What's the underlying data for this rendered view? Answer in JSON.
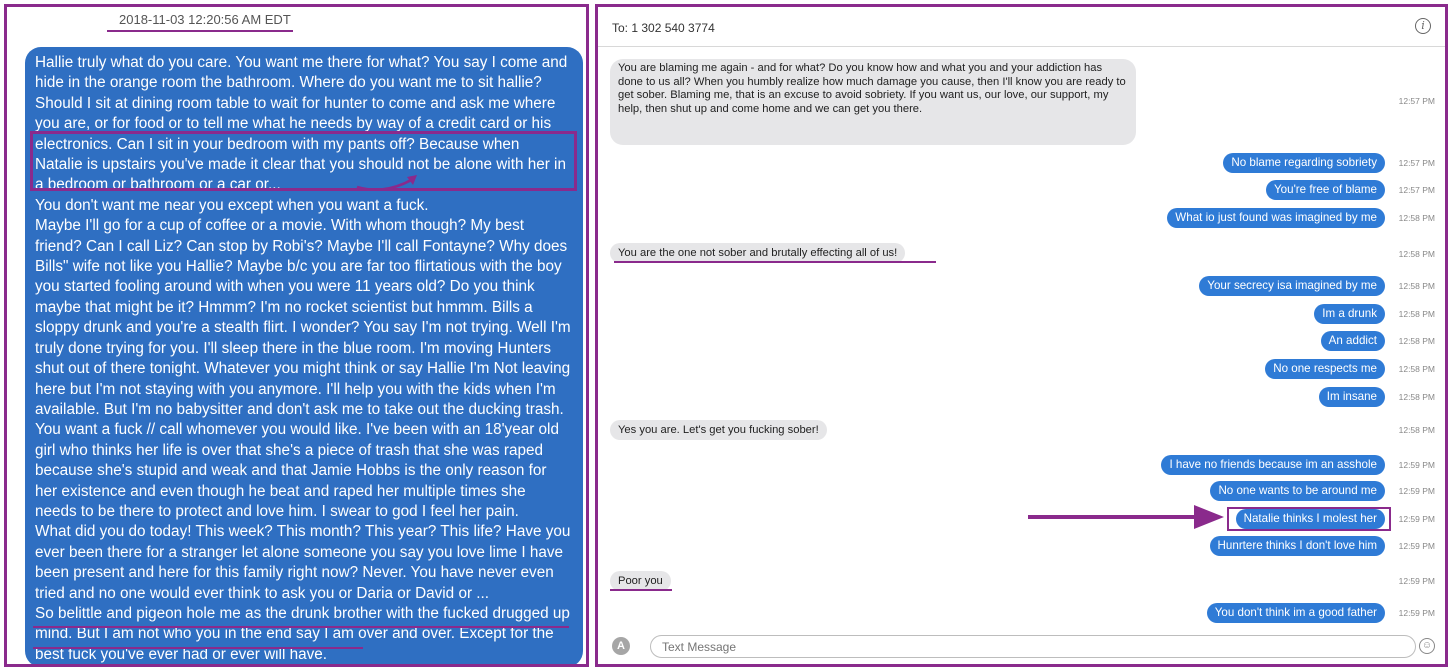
{
  "left": {
    "timestamp": "2018-11-03 12:20:56 AM EDT",
    "message_paragraphs": [
      "Hallie truly what do you care. You want me there for what? You say I come and hide in the orange room the bathroom. Where do you want me to sit hallie? Should I sit at dining room table to wait for hunter to come and ask me where you are, or for food or to tell me what he needs by way of a credit card or his electronics. Can I sit in your bedroom with my pants off? Because when Natalie is upstairs you've made it clear that you should not be alone with her in a bedroom or bathroom or a car or..,",
      "You don't want me near you except when you want a fuck.",
      "Maybe I'll go for a cup of coffee or a movie. With whom though? My best friend? Can I call Liz? Can stop by Robi's? Maybe I'll call Fontayne? Why does Bills\" wife not like you Hallie? Maybe b/c you are far too flirtatious with the boy you started fooling around with when you were 11 years old? Do you think maybe that might be it? Hmmm? I'm no rocket scientist but hmmm. Bills a sloppy drunk and you're a stealth flirt. I wonder? You say I'm not trying. Well I'm truly done trying for you. I'll sleep there in the blue room. I'm moving Hunters shut out of there tonight. Whatever you might think or say Hallie I'm Not leaving here but I'm not staying with you anymore. I'll help you with the kids when I'm available. But I'm no babysitter and don't ask me to take out the ducking trash. You want a fuck // call whomever you would like. I've been with an 18'year old girl who thinks her life is over that she's a piece of trash that she was raped because she's stupid and weak and that Jamie Hobbs is the only reason for her existence and even though he beat and raped her multiple times she needs to be there to protect and love him. I swear to god I feel her pain.",
      "What did you do today! This week? This month? This year? This life? Have you ever been there for a stranger let alone someone you say you love lime I have been present and here for this family right now? Never. You have never even tried and no one would ever think to ask you or Daria or David or ...",
      "So belittle and pigeon hole me as the drunk brother with the fucked drugged up mind. But I am not who you in the end say I am over and over. Except for the best fuck you've ever had or ever will have."
    ]
  },
  "right": {
    "to_line": "To: 1 302 540 3774",
    "messages": [
      {
        "dir": "in",
        "text": "You are blaming me again - and for what? Do you know how and what you and your addiction has done to us all? When you humbly realize how much damage you cause, then I'll know you are ready to get sober. Blaming me, that is an excuse to avoid sobriety. If you want us, our love, our support, my help, then shut up and come home and we can get you there.",
        "time": "12:57 PM"
      },
      {
        "dir": "out",
        "text": "No blame regarding sobriety",
        "time": "12:57 PM"
      },
      {
        "dir": "out",
        "text": "You're free of blame",
        "time": "12:57 PM"
      },
      {
        "dir": "out",
        "text": "What io just found was imagined by me",
        "time": "12:58 PM"
      },
      {
        "dir": "in",
        "text": "You are the one not sober and brutally effecting all of us!",
        "time": "12:58 PM"
      },
      {
        "dir": "out",
        "text": "Your secrecy isa imagined by me",
        "time": "12:58 PM"
      },
      {
        "dir": "out",
        "text": "Im a drunk",
        "time": "12:58 PM"
      },
      {
        "dir": "out",
        "text": "An addict",
        "time": "12:58 PM"
      },
      {
        "dir": "out",
        "text": "No one respects me",
        "time": "12:58 PM"
      },
      {
        "dir": "out",
        "text": "Im insane",
        "time": "12:58 PM"
      },
      {
        "dir": "in",
        "text": "Yes you are. Let's get you fucking sober!",
        "time": "12:58 PM"
      },
      {
        "dir": "out",
        "text": "I have no friends because im an asshole",
        "time": "12:59 PM"
      },
      {
        "dir": "out",
        "text": "No one wants to be around me",
        "time": "12:59 PM"
      },
      {
        "dir": "out",
        "text": "Natalie thinks I molest her",
        "time": "12:59 PM"
      },
      {
        "dir": "out",
        "text": "Hunrtere thinks I don't love him",
        "time": "12:59 PM"
      },
      {
        "dir": "in",
        "text": "Poor you",
        "time": "12:59 PM"
      },
      {
        "dir": "out",
        "text": "You don't think im a good father",
        "time": "12:59 PM"
      }
    ],
    "compose_placeholder": "Text Message",
    "icons": {
      "info": "info-icon",
      "apps": "app-store-icon",
      "emoji": "emoji-icon"
    }
  },
  "colors": {
    "annotation": "#8a2a8c",
    "bubble_blue": "#2f7bd6",
    "bubble_gray": "#e6e6e8"
  }
}
